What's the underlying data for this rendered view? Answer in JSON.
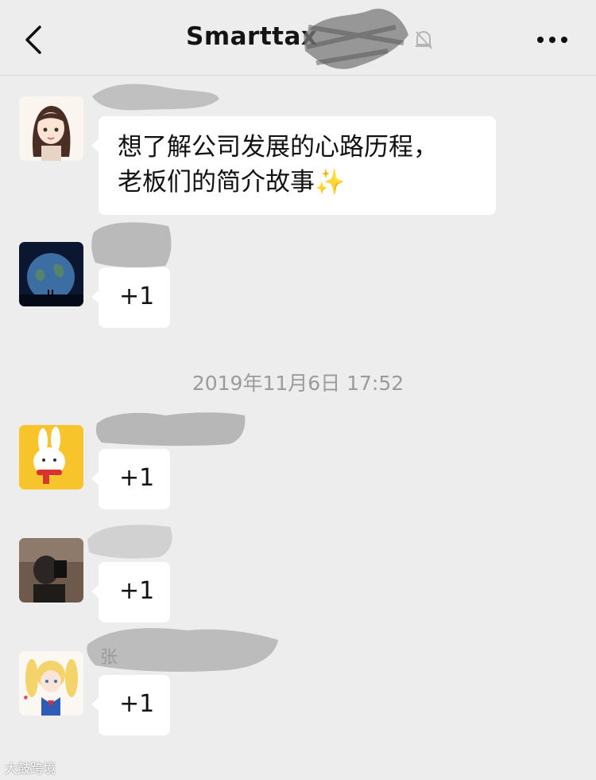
{
  "header": {
    "title": "Smarttax",
    "back_icon": "chevron-left-icon",
    "mute_icon": "bell-off-icon",
    "more_icon": "more-dots-icon"
  },
  "messages": [
    {
      "avatar": "cartoon-girl-avatar",
      "line1": "想了解公司发展的心路历程，",
      "line2": "老板们的简介故事",
      "emoji": "✨"
    },
    {
      "avatar": "earth-avatar",
      "text": "+1"
    },
    {
      "avatar": "rabbit-avatar",
      "text": "+1"
    },
    {
      "avatar": "photo-person-avatar",
      "text": "+1"
    },
    {
      "avatar": "sailor-moon-avatar",
      "text": "+1",
      "sender_partial": "张"
    }
  ],
  "timestamp": "2019年11月6日 17:52",
  "watermark": "大鼓跨境",
  "colors": {
    "background": "#ededed",
    "bubble": "#ffffff",
    "timestamp": "#9b9b9b"
  }
}
